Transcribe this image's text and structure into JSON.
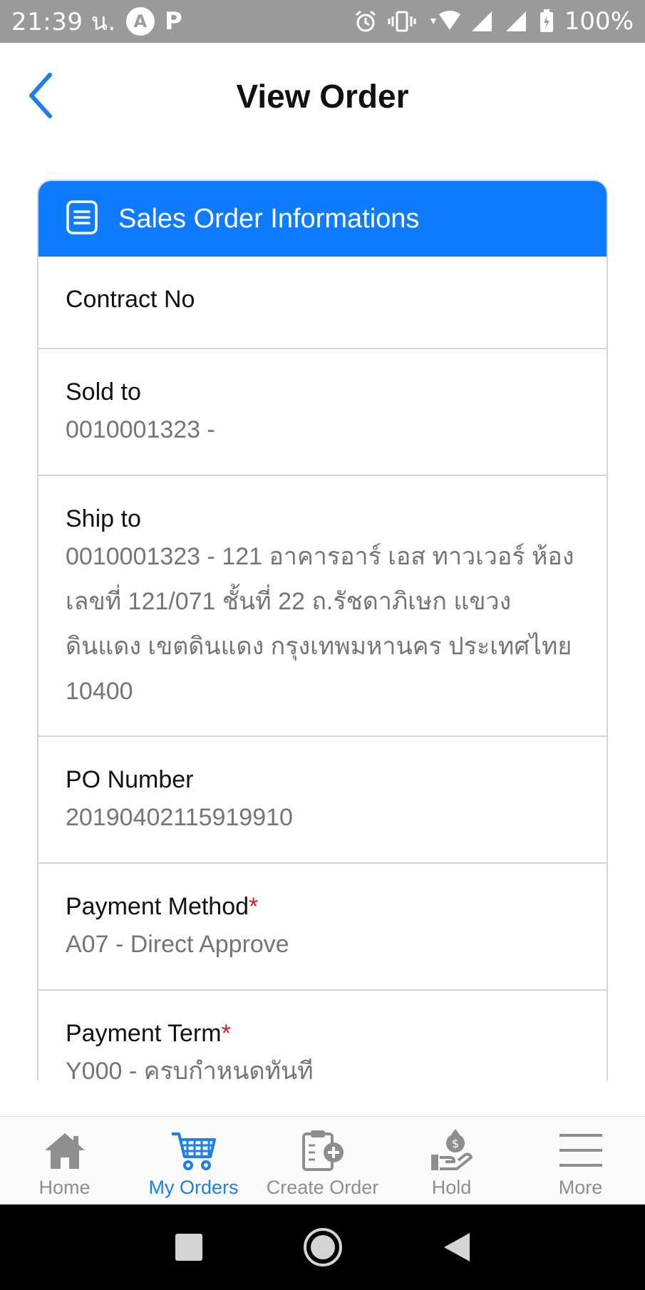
{
  "status_bar": {
    "time": "21:39 น.",
    "badge": "A",
    "p_icon": "P",
    "battery_pct": "100%"
  },
  "header": {
    "title": "View Order",
    "back_icon": "chevron-left-icon"
  },
  "card": {
    "title": "Sales Order Informations",
    "icon": "document-icon",
    "accent": "#0f7bff"
  },
  "fields": {
    "contract_no": {
      "label": "Contract No",
      "value": ""
    },
    "sold_to": {
      "label": "Sold to",
      "value": "0010001323 -"
    },
    "ship_to": {
      "label": "Ship to",
      "value_lines": [
        "0010001323 - 121 อาคารอาร์ เอส ทาวเวอร์ ห้อง",
        "เลขที่ 121/071 ชั้นที่ 22 ถ.รัชดาภิเษก แขวง",
        "ดินแดง เขตดินแดง กรุงเทพมหานคร ประเทศไทย",
        "10400"
      ]
    },
    "po_number": {
      "label": "PO Number",
      "value": "20190402115919910"
    },
    "payment_method": {
      "label": "Payment Method",
      "required": "*",
      "value": "A07 - Direct Approve"
    },
    "payment_term": {
      "label": "Payment Term",
      "required": "*",
      "value": "Y000 - ครบกำหนดทันที"
    }
  },
  "bottom_nav": {
    "items": [
      {
        "label": "Home",
        "icon": "home-icon"
      },
      {
        "label": "My Orders",
        "icon": "cart-icon",
        "active": true
      },
      {
        "label": "Create Order",
        "icon": "clipboard-add-icon"
      },
      {
        "label": "Hold",
        "icon": "money-hand-icon"
      },
      {
        "label": "More",
        "icon": "menu-icon"
      }
    ],
    "active_color": "#1a7fe8",
    "inactive_color": "#8e8e8e"
  }
}
